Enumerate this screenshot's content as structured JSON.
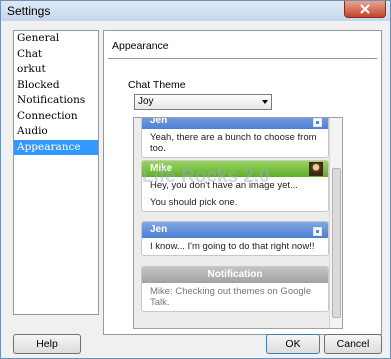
{
  "window": {
    "title": "Settings"
  },
  "sidebar": {
    "items": [
      {
        "label": "General",
        "selected": false
      },
      {
        "label": "Chat",
        "selected": false
      },
      {
        "label": "orkut",
        "selected": false
      },
      {
        "label": "Blocked",
        "selected": false
      },
      {
        "label": "Notifications",
        "selected": false
      },
      {
        "label": "Connection",
        "selected": false
      },
      {
        "label": "Audio",
        "selected": false
      },
      {
        "label": "Appearance",
        "selected": true
      }
    ]
  },
  "panel": {
    "title": "Appearance",
    "chat_theme_label": "Chat Theme",
    "theme_select": {
      "value": "Joy"
    }
  },
  "preview": {
    "messages": [
      {
        "sender": "Jen",
        "lines": [
          "Yeah, there are a bunch to choose from too."
        ]
      },
      {
        "sender": "Mike",
        "lines": [
          "Hey, you don't have an image yet...",
          "You should pick one."
        ]
      },
      {
        "sender": "Jen",
        "lines": [
          "I know... I'm going to do that right now!!"
        ]
      },
      {
        "sender": "Notification",
        "lines": [
          "Mike: Checking out themes on Google Talk."
        ]
      }
    ],
    "watermark": "Life Rocks 2.0"
  },
  "buttons": {
    "help": "Help",
    "ok": "OK",
    "cancel": "Cancel"
  },
  "colors": {
    "selection": "#3399ff",
    "jen_header": "#4f7fd2",
    "mike_header": "#5fae27",
    "notification_header": "#a2a2a2"
  },
  "icons": [
    "close-icon",
    "chevron-down-icon",
    "avatar-icon"
  ]
}
